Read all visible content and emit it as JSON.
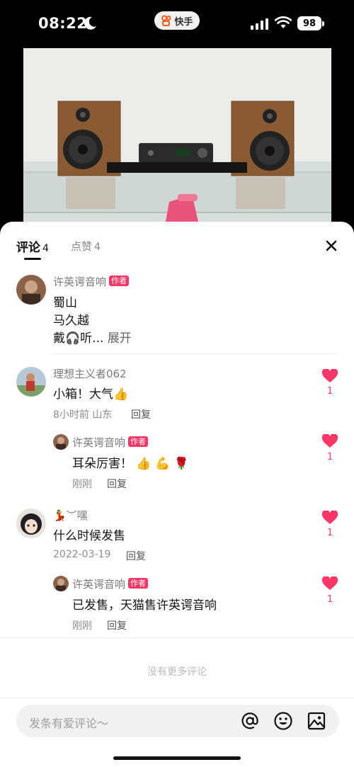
{
  "status": {
    "time": "08:22",
    "app_name": "快手",
    "battery": "98"
  },
  "tabs": [
    {
      "label": "评论",
      "count": "4"
    },
    {
      "label": "点赞",
      "count": "4"
    }
  ],
  "comments": [
    {
      "user": "许英谔音响",
      "badge": "作者",
      "lines": [
        "蜀山",
        "马久越",
        "戴🎧听..."
      ],
      "expand": "展开"
    },
    {
      "user": "理想主义者062",
      "text": "小箱！大气👍",
      "meta": "8小时前 山东",
      "reply": "回复",
      "likes": "1",
      "sub": {
        "user": "许英谔音响",
        "badge": "作者",
        "text": "耳朵厉害！ 👍 💪 🌹",
        "meta": "刚刚",
        "reply": "回复",
        "likes": "1"
      }
    },
    {
      "user": "💃︶嘿",
      "text": "什么时候发售",
      "meta": "2022-03-19",
      "reply": "回复",
      "likes": "1",
      "sub": {
        "user": "许英谔音响",
        "badge": "作者",
        "text": "已发售，天猫售许英谔音响",
        "meta": "刚刚",
        "reply": "回复",
        "likes": "1"
      }
    }
  ],
  "no_more": "没有更多评论",
  "input": {
    "placeholder": "发条有爱评论～"
  },
  "colors": {
    "accent": "#fe3666",
    "app_brand": "#ff5b1a"
  }
}
